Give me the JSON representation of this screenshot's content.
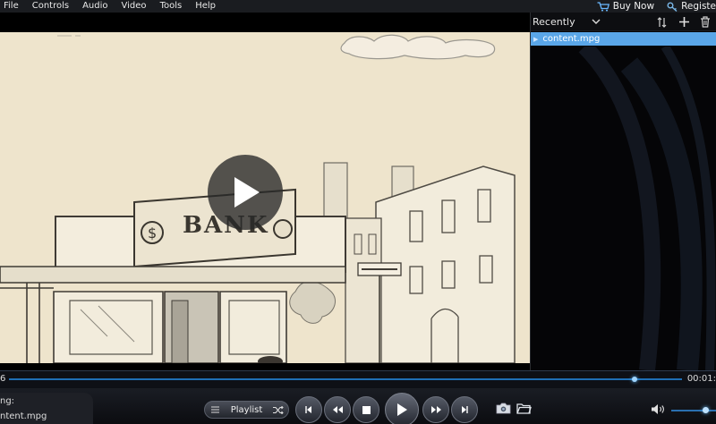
{
  "menu": {
    "items": [
      "File",
      "Controls",
      "Audio",
      "Video",
      "Tools",
      "Help"
    ],
    "buy_now": "Buy Now",
    "register": "Registe"
  },
  "video": {
    "sign_text": "BANK"
  },
  "playlist": {
    "sort_label": "Recently",
    "items": [
      {
        "name": "content.mpg",
        "selected": true
      }
    ]
  },
  "seek": {
    "time_left": "6",
    "time_right": "00:01:",
    "progress": 0.93
  },
  "info": {
    "label": "ng:",
    "file": "ntent.mpg"
  },
  "controls": {
    "playlist_label": "Playlist"
  },
  "volume": {
    "level": 0.76
  },
  "colors": {
    "accent": "#5aa6e8",
    "seek_track": "#1f6fb5",
    "video_bg": "#efe6d0"
  },
  "icons": {
    "buy_now": "cart-icon",
    "register": "key-icon",
    "sort_dropdown": "chevron-down-icon",
    "sort": "sort-icon",
    "add": "plus-icon",
    "delete": "trash-icon",
    "play_overlay": "play-icon",
    "prev_chapter": "skip-back-icon",
    "rewind": "rewind-icon",
    "stop": "stop-icon",
    "play": "play-icon",
    "forward": "fast-forward-icon",
    "next_chapter": "skip-forward-icon",
    "snapshot": "camera-icon",
    "open": "folder-icon",
    "volume": "speaker-icon",
    "shuffle": "shuffle-icon",
    "playlist_lines": "list-icon"
  }
}
